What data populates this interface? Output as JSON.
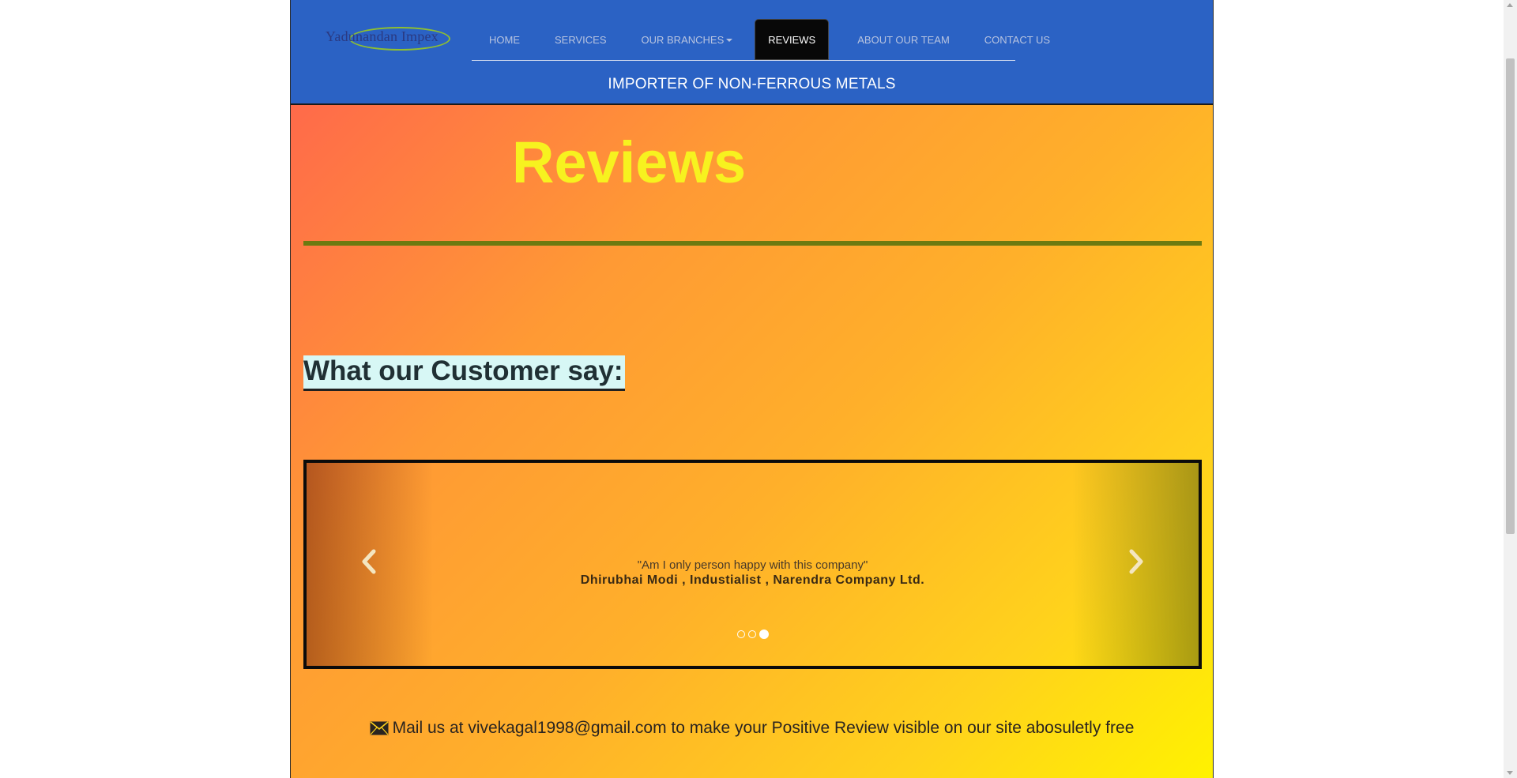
{
  "brand": {
    "name": "Yadunandan Impex"
  },
  "nav": {
    "items": [
      {
        "label": "HOME"
      },
      {
        "label": "SERVICES"
      },
      {
        "label": "OUR BRANCHES"
      },
      {
        "label": "REVIEWS"
      },
      {
        "label": "ABOUT OUR TEAM"
      },
      {
        "label": "CONTACT US"
      }
    ],
    "active_index": 3
  },
  "tagline": "IMPORTER OF NON-FERROUS METALS",
  "main": {
    "title": "Reviews",
    "customer_heading": "What our Customer say:",
    "carousel": {
      "quote": "\"Am I only person happy with this company\"",
      "author": "Dhirubhai Modi , Industialist , Narendra Company Ltd.",
      "slide_count": 3,
      "active_slide": 3
    },
    "mail_line": "Mail us at vivekagal1998@gmail.com to make your Positive Review visible on our site abosuletly free"
  },
  "colors": {
    "header_bg": "#2b62c4",
    "title": "#f7f21f",
    "divider": "#6d7a10",
    "heading_highlight": "#d7f7f5"
  },
  "icons": {
    "prev": "chevron-left-icon",
    "next": "chevron-right-icon",
    "mail": "envelope-icon",
    "dropdown": "caret-down-icon"
  }
}
